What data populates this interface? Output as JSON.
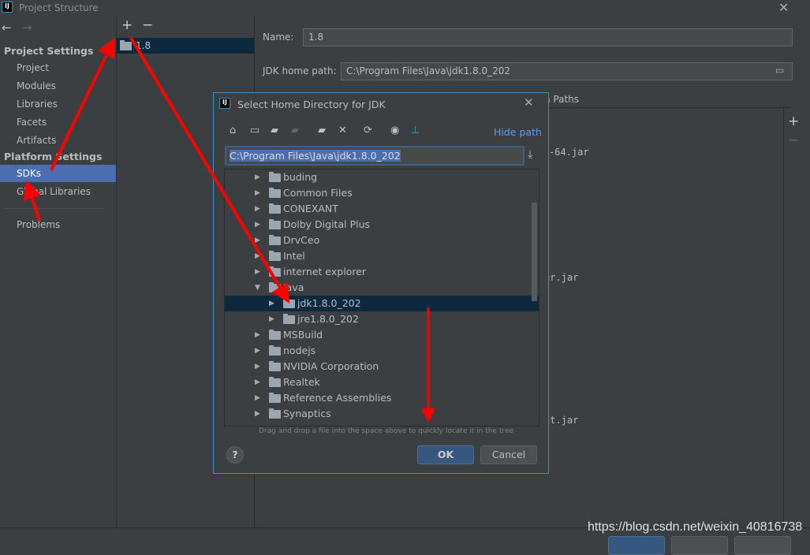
{
  "window": {
    "title": "Project Structure"
  },
  "sidebar": {
    "project_settings": "Project Settings",
    "project_items": [
      {
        "label": "Project"
      },
      {
        "label": "Modules"
      },
      {
        "label": "Libraries"
      },
      {
        "label": "Facets"
      },
      {
        "label": "Artifacts"
      }
    ],
    "platform_settings": "Platform Settings",
    "platform_items": [
      {
        "label": "SDKs",
        "selected": true
      },
      {
        "label": "Global Libraries"
      }
    ],
    "problems": "Problems"
  },
  "sdk_list": {
    "items": [
      {
        "label": "1.8"
      }
    ]
  },
  "details": {
    "name_label": "Name:",
    "name_value": "1.8",
    "home_label": "JDK home path:",
    "home_value": "C:\\Program Files\\Java\\jdk1.8.0_202",
    "tab_fragment": "n Paths",
    "jar_fragments": [
      "-64.jar",
      "er.jar",
      "nt.jar"
    ]
  },
  "dialog": {
    "title": "Select Home Directory for JDK",
    "hide_path": "Hide path",
    "path_value": "C:\\Program Files\\Java\\jdk1.8.0_202",
    "tree": [
      {
        "label": "buding",
        "level": 0,
        "expanded": false
      },
      {
        "label": "Common Files",
        "level": 0,
        "expanded": false
      },
      {
        "label": "CONEXANT",
        "level": 0,
        "expanded": false
      },
      {
        "label": "Dolby Digital Plus",
        "level": 0,
        "expanded": false
      },
      {
        "label": "DrvCeo",
        "level": 0,
        "expanded": false
      },
      {
        "label": "Intel",
        "level": 0,
        "expanded": false
      },
      {
        "label": "internet explorer",
        "level": 0,
        "expanded": false
      },
      {
        "label": "Java",
        "level": 0,
        "expanded": true
      },
      {
        "label": "jdk1.8.0_202",
        "level": 1,
        "expanded": false,
        "selected": true
      },
      {
        "label": "jre1.8.0_202",
        "level": 1,
        "expanded": false
      },
      {
        "label": "MSBuild",
        "level": 0,
        "expanded": false
      },
      {
        "label": "nodejs",
        "level": 0,
        "expanded": false
      },
      {
        "label": "NVIDIA Corporation",
        "level": 0,
        "expanded": false
      },
      {
        "label": "Realtek",
        "level": 0,
        "expanded": false
      },
      {
        "label": "Reference Assemblies",
        "level": 0,
        "expanded": false
      },
      {
        "label": "Synaptics",
        "level": 0,
        "expanded": false
      }
    ],
    "hint": "Drag and drop a file into the space above to quickly locate it in the tree",
    "ok": "OK",
    "cancel": "Cancel",
    "help": "?"
  },
  "watermark": "https://blog.csdn.net/weixin_40816738",
  "colors": {
    "selection": "#4b6eaf",
    "tree_selection": "#0d293e",
    "accent": "#3592c4",
    "link": "#589df6",
    "annotation": "#ff0000"
  }
}
